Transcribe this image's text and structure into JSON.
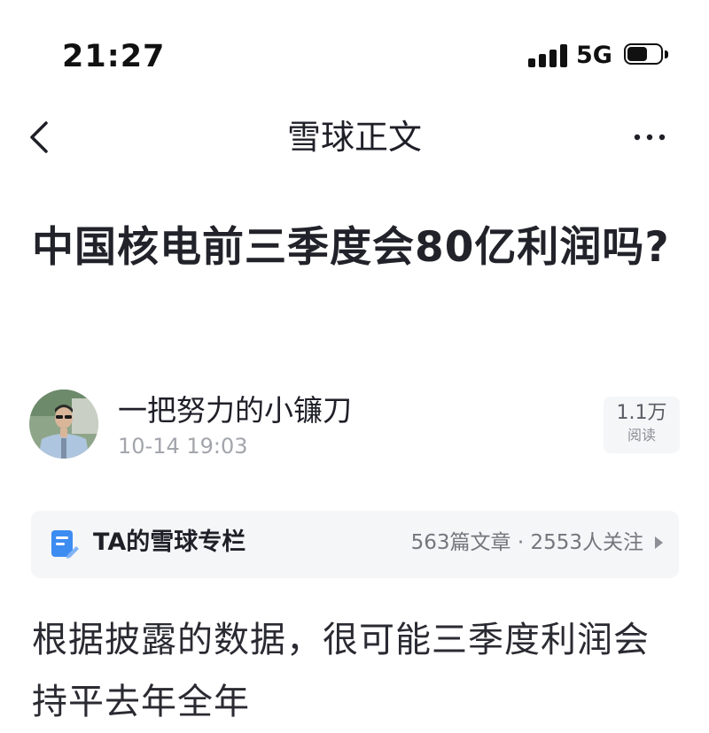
{
  "status_bar": {
    "time": "21:27",
    "network": "5G",
    "battery_level": 0.6
  },
  "nav": {
    "title": "雪球正文"
  },
  "article": {
    "title": "中国核电前三季度会80亿利润吗?",
    "body": "根据披露的数据，很可能三季度利润会持平去年全年"
  },
  "author": {
    "name": "一把努力的小镰刀",
    "time": "10-14 19:03",
    "views_count": "1.1万",
    "views_label": "阅读"
  },
  "column": {
    "label": "TA的雪球专栏",
    "stats": "563篇文章 · 2553人关注"
  },
  "colors": {
    "accent_blue": "#3d8cf2",
    "card_bg": "#f5f6f8",
    "muted_text": "#a3a5ac"
  }
}
